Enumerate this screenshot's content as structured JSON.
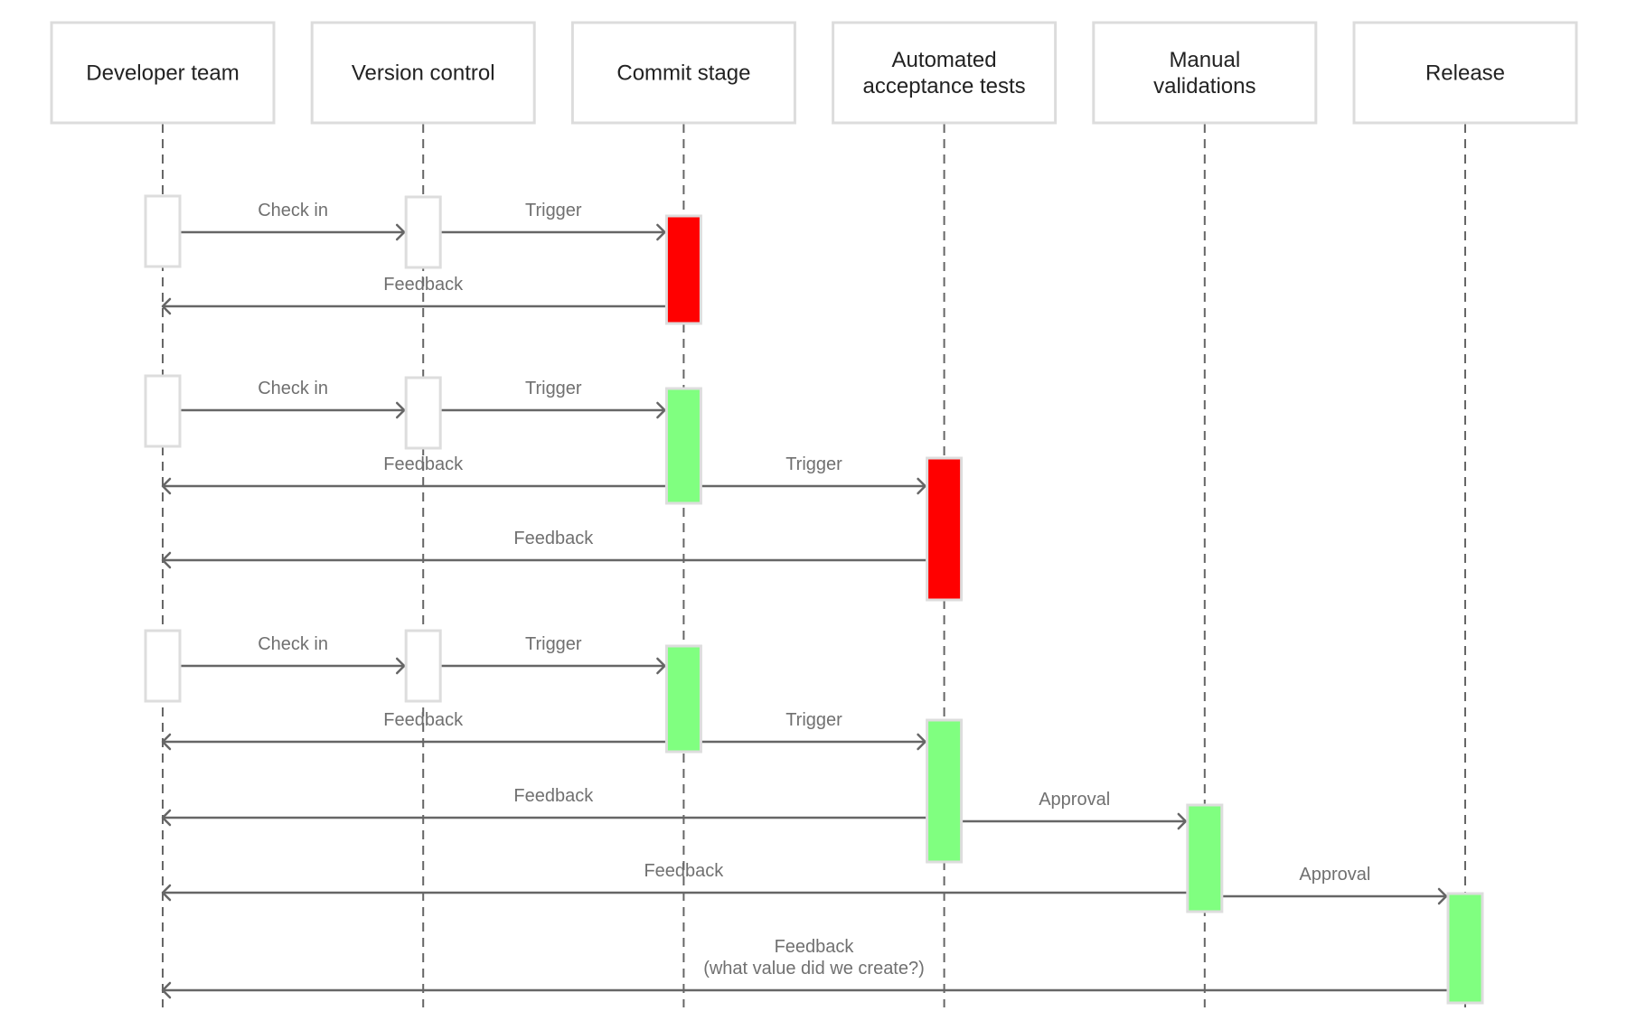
{
  "diagram": {
    "type": "sequence",
    "colors": {
      "fail": "#ff0000",
      "pass": "#80ff80",
      "neutral": "#ffffff"
    },
    "actors": [
      {
        "id": "dev",
        "label_lines": [
          "Developer team"
        ]
      },
      {
        "id": "vc",
        "label_lines": [
          "Version control"
        ]
      },
      {
        "id": "commit",
        "label_lines": [
          "Commit stage"
        ]
      },
      {
        "id": "aat",
        "label_lines": [
          "Automated",
          "acceptance tests"
        ]
      },
      {
        "id": "mv",
        "label_lines": [
          "Manual",
          "validations"
        ]
      },
      {
        "id": "release",
        "label_lines": [
          "Release"
        ]
      }
    ],
    "activations": [
      {
        "actor": "dev",
        "status": "neutral",
        "start_step": 1,
        "end_step": 1
      },
      {
        "actor": "vc",
        "status": "neutral",
        "start_step": 1,
        "end_step": 1
      },
      {
        "actor": "commit",
        "status": "fail",
        "start_step": 1,
        "end_step": 2
      },
      {
        "actor": "dev",
        "status": "neutral",
        "start_step": 3,
        "end_step": 3
      },
      {
        "actor": "vc",
        "status": "neutral",
        "start_step": 3,
        "end_step": 3
      },
      {
        "actor": "commit",
        "status": "pass",
        "start_step": 3,
        "end_step": 4
      },
      {
        "actor": "aat",
        "status": "fail",
        "start_step": 4,
        "end_step": 5
      },
      {
        "actor": "dev",
        "status": "neutral",
        "start_step": 6,
        "end_step": 6
      },
      {
        "actor": "vc",
        "status": "neutral",
        "start_step": 6,
        "end_step": 6
      },
      {
        "actor": "commit",
        "status": "pass",
        "start_step": 6,
        "end_step": 7
      },
      {
        "actor": "aat",
        "status": "pass",
        "start_step": 7,
        "end_step": 8
      },
      {
        "actor": "mv",
        "status": "pass",
        "start_step": 8,
        "end_step": 9
      },
      {
        "actor": "release",
        "status": "pass",
        "start_step": 9,
        "end_step": 10
      }
    ],
    "messages": [
      {
        "from": "dev",
        "to": "vc",
        "label_lines": [
          "Check in"
        ],
        "step": 1
      },
      {
        "from": "vc",
        "to": "commit",
        "label_lines": [
          "Trigger"
        ],
        "step": 1
      },
      {
        "from": "commit",
        "to": "dev",
        "label_lines": [
          "Feedback"
        ],
        "step": 2
      },
      {
        "from": "dev",
        "to": "vc",
        "label_lines": [
          "Check in"
        ],
        "step": 3
      },
      {
        "from": "vc",
        "to": "commit",
        "label_lines": [
          "Trigger"
        ],
        "step": 3
      },
      {
        "from": "commit",
        "to": "dev",
        "label_lines": [
          "Feedback"
        ],
        "step": 4
      },
      {
        "from": "commit",
        "to": "aat",
        "label_lines": [
          "Trigger"
        ],
        "step": 4
      },
      {
        "from": "aat",
        "to": "dev",
        "label_lines": [
          "Feedback"
        ],
        "step": 5
      },
      {
        "from": "dev",
        "to": "vc",
        "label_lines": [
          "Check in"
        ],
        "step": 6
      },
      {
        "from": "vc",
        "to": "commit",
        "label_lines": [
          "Trigger"
        ],
        "step": 6
      },
      {
        "from": "commit",
        "to": "dev",
        "label_lines": [
          "Feedback"
        ],
        "step": 7
      },
      {
        "from": "commit",
        "to": "aat",
        "label_lines": [
          "Trigger"
        ],
        "step": 7
      },
      {
        "from": "aat",
        "to": "dev",
        "label_lines": [
          "Feedback"
        ],
        "step": 8
      },
      {
        "from": "aat",
        "to": "mv",
        "label_lines": [
          "Approval"
        ],
        "step": 8
      },
      {
        "from": "mv",
        "to": "dev",
        "label_lines": [
          "Feedback"
        ],
        "step": 9
      },
      {
        "from": "mv",
        "to": "release",
        "label_lines": [
          "Approval"
        ],
        "step": 9
      },
      {
        "from": "release",
        "to": "dev",
        "label_lines": [
          "Feedback",
          "(what value did we create?)"
        ],
        "step": 10
      }
    ]
  }
}
